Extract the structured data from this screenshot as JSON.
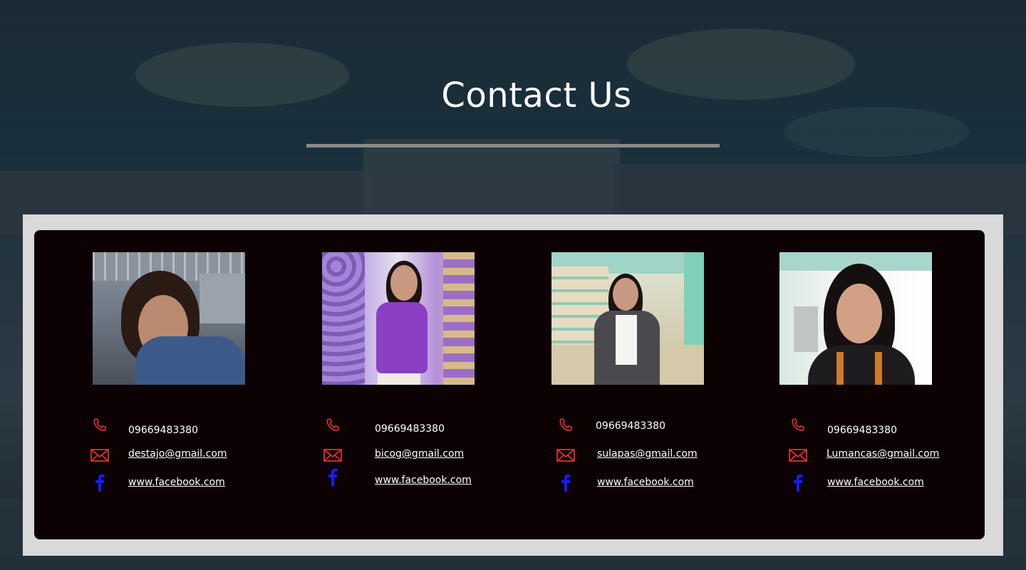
{
  "header": {
    "title": "Contact Us"
  },
  "colors": {
    "panel_bg": "#0c0203",
    "frame_bg": "#d9d9d9",
    "phone_icon": "#e0302c",
    "mail_icon": "#e0302c",
    "facebook_icon": "#1a1aff",
    "text": "#ffffff"
  },
  "icons": {
    "phone": "phone-icon",
    "mail": "mail-icon",
    "facebook": "facebook-icon"
  },
  "contacts": [
    {
      "photo_alt": "contact photo",
      "phone": "09669483380",
      "email": "destajo@gmail.com",
      "facebook": "www.facebook.com"
    },
    {
      "photo_alt": "contact photo",
      "phone": "09669483380",
      "email": "bicog@gmail.com",
      "facebook": "www.facebook.com"
    },
    {
      "photo_alt": "contact photo",
      "phone": "09669483380",
      "email": "sulapas@gmail.com",
      "facebook": "www.facebook.com"
    },
    {
      "photo_alt": "contact photo",
      "phone": "09669483380",
      "email": "Lumancas@gmail.com",
      "facebook": "www.facebook.com"
    }
  ]
}
